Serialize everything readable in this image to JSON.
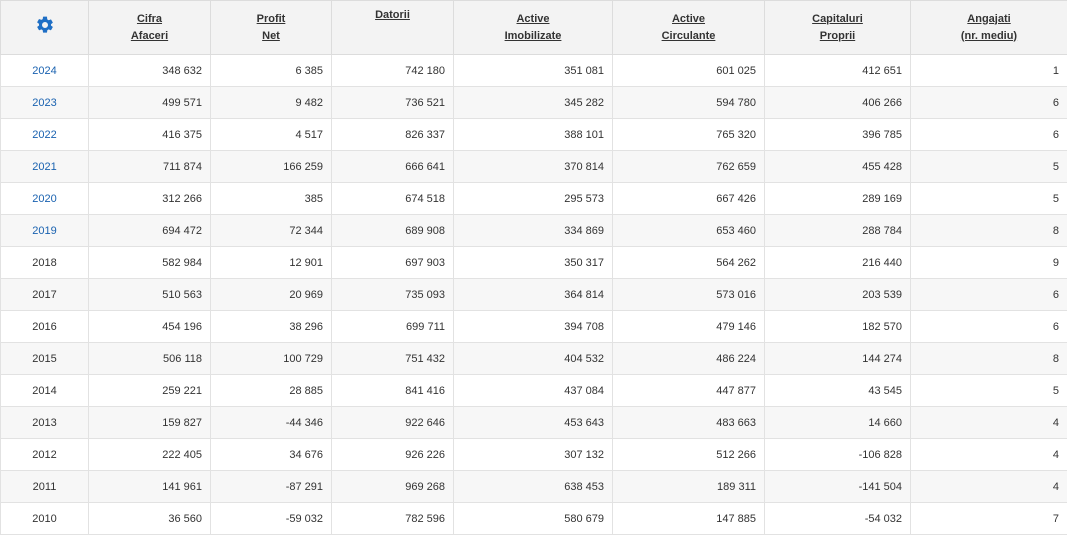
{
  "icons": {
    "settings": "gear-icon"
  },
  "colors": {
    "accent": "#1f6fc5",
    "link": "#1a62b0",
    "header_bg": "#f3f3f3",
    "border": "#dcdcdc"
  },
  "headers": [
    {
      "key": "cifra",
      "line1": "Cifra",
      "line2": "Afaceri"
    },
    {
      "key": "profit",
      "line1": "Profit",
      "line2": "Net"
    },
    {
      "key": "datorii",
      "line1": "Datorii",
      "line2": ""
    },
    {
      "key": "active_imob",
      "line1": "Active",
      "line2": "Imobilizate"
    },
    {
      "key": "active_circ",
      "line1": "Active",
      "line2": "Circulante"
    },
    {
      "key": "capitaluri",
      "line1": "Capitaluri",
      "line2": "Proprii"
    },
    {
      "key": "angajati",
      "line1": "Angajati",
      "line2": "(nr. mediu)"
    }
  ],
  "rows": [
    {
      "year": "2024",
      "link": true,
      "values": [
        "348 632",
        "6 385",
        "742 180",
        "351 081",
        "601 025",
        "412 651",
        "1"
      ]
    },
    {
      "year": "2023",
      "link": true,
      "values": [
        "499 571",
        "9 482",
        "736 521",
        "345 282",
        "594 780",
        "406 266",
        "6"
      ]
    },
    {
      "year": "2022",
      "link": true,
      "values": [
        "416 375",
        "4 517",
        "826 337",
        "388 101",
        "765 320",
        "396 785",
        "6"
      ]
    },
    {
      "year": "2021",
      "link": true,
      "values": [
        "711 874",
        "166 259",
        "666 641",
        "370 814",
        "762 659",
        "455 428",
        "5"
      ]
    },
    {
      "year": "2020",
      "link": true,
      "values": [
        "312 266",
        "385",
        "674 518",
        "295 573",
        "667 426",
        "289 169",
        "5"
      ]
    },
    {
      "year": "2019",
      "link": true,
      "values": [
        "694 472",
        "72 344",
        "689 908",
        "334 869",
        "653 460",
        "288 784",
        "8"
      ]
    },
    {
      "year": "2018",
      "link": false,
      "values": [
        "582 984",
        "12 901",
        "697 903",
        "350 317",
        "564 262",
        "216 440",
        "9"
      ]
    },
    {
      "year": "2017",
      "link": false,
      "values": [
        "510 563",
        "20 969",
        "735 093",
        "364 814",
        "573 016",
        "203 539",
        "6"
      ]
    },
    {
      "year": "2016",
      "link": false,
      "values": [
        "454 196",
        "38 296",
        "699 711",
        "394 708",
        "479 146",
        "182 570",
        "6"
      ]
    },
    {
      "year": "2015",
      "link": false,
      "values": [
        "506 118",
        "100 729",
        "751 432",
        "404 532",
        "486 224",
        "144 274",
        "8"
      ]
    },
    {
      "year": "2014",
      "link": false,
      "values": [
        "259 221",
        "28 885",
        "841 416",
        "437 084",
        "447 877",
        "43 545",
        "5"
      ]
    },
    {
      "year": "2013",
      "link": false,
      "values": [
        "159 827",
        "-44 346",
        "922 646",
        "453 643",
        "483 663",
        "14 660",
        "4"
      ]
    },
    {
      "year": "2012",
      "link": false,
      "values": [
        "222 405",
        "34 676",
        "926 226",
        "307 132",
        "512 266",
        "-106 828",
        "4"
      ]
    },
    {
      "year": "2011",
      "link": false,
      "values": [
        "141 961",
        "-87 291",
        "969 268",
        "638 453",
        "189 311",
        "-141 504",
        "4"
      ]
    },
    {
      "year": "2010",
      "link": false,
      "values": [
        "36 560",
        "-59 032",
        "782 596",
        "580 679",
        "147 885",
        "-54 032",
        "7"
      ]
    }
  ]
}
